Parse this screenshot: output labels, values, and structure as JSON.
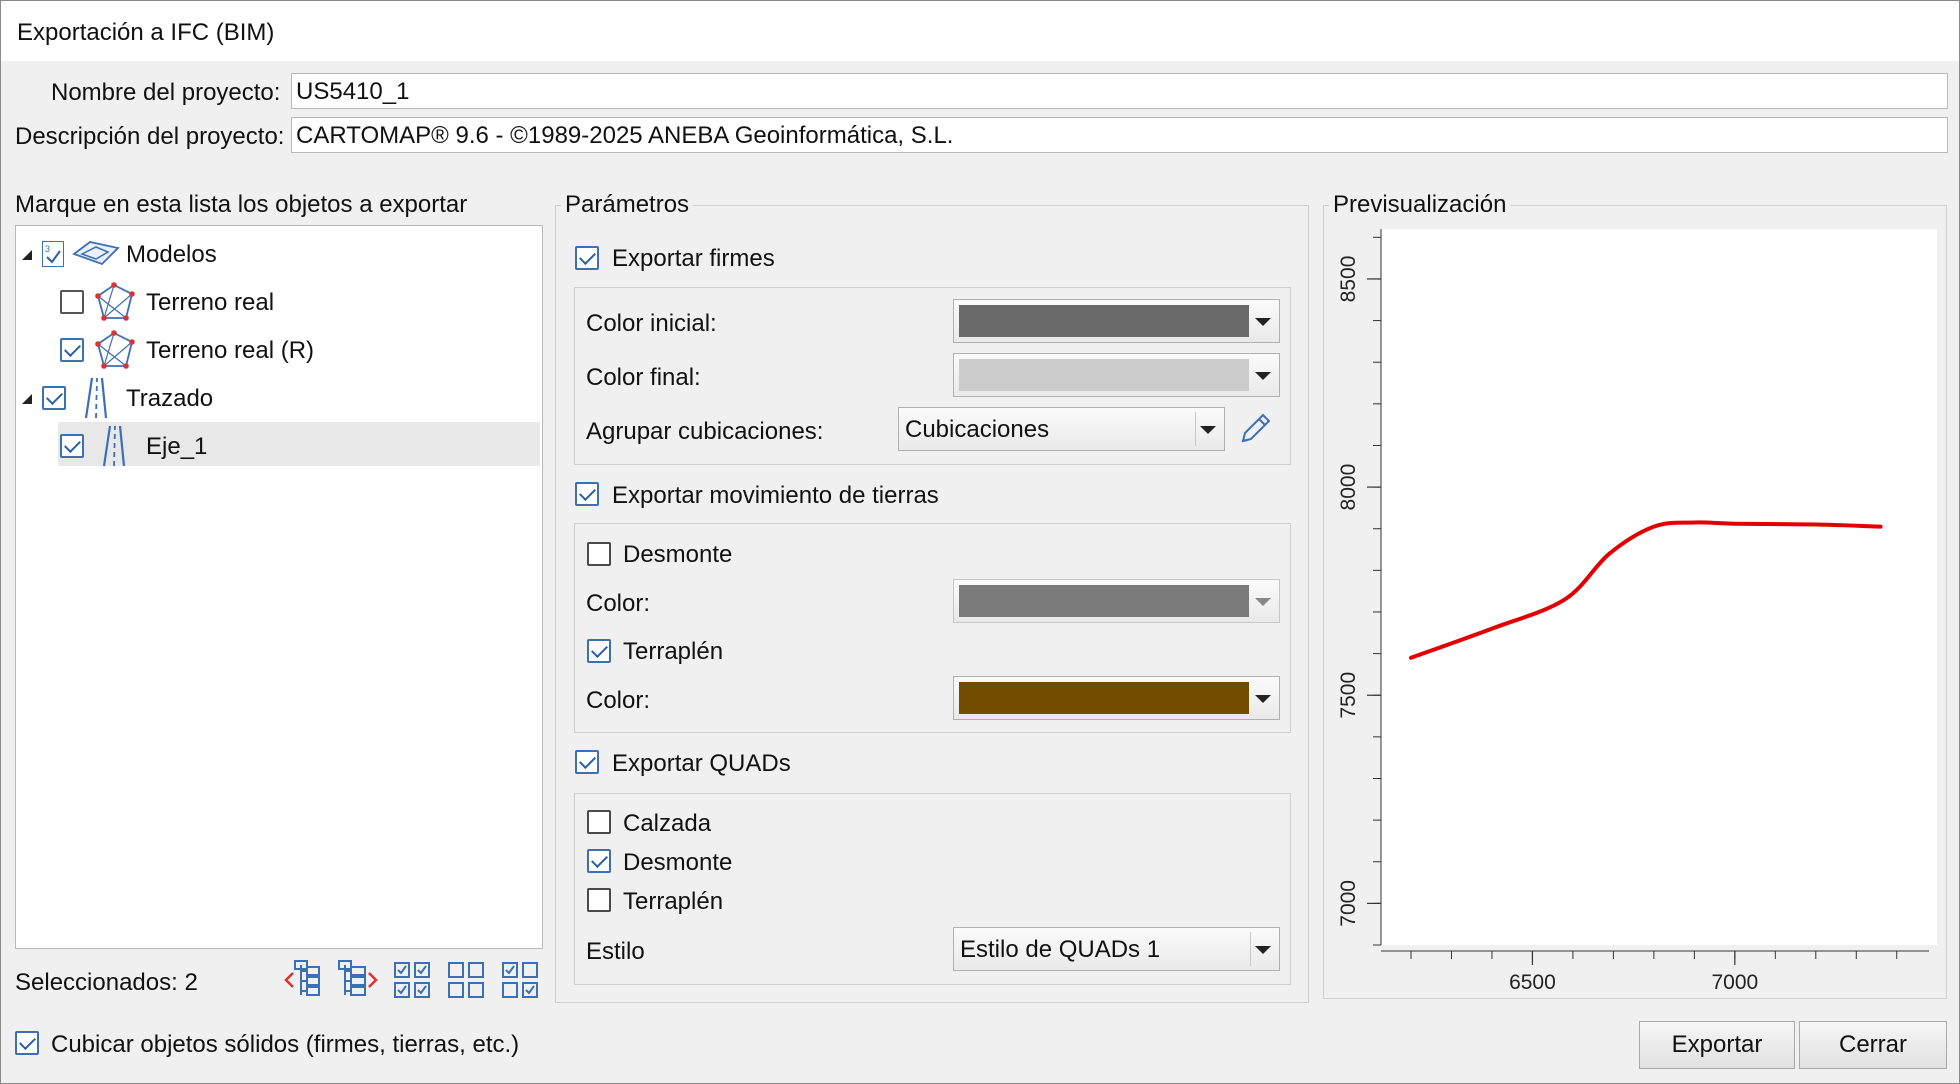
{
  "window": {
    "title": "Exportación a IFC (BIM)"
  },
  "project": {
    "name_label": "Nombre del proyecto:",
    "name_value": "US5410_1",
    "desc_label": "Descripción del proyecto:",
    "desc_value": "CARTOMAP® 9.6 - ©1989-2025 ANEBA Geoinformática, S.L."
  },
  "objects": {
    "title": "Marque en esta lista los objetos a exportar",
    "items": [
      {
        "label": "Modelos",
        "checked": true,
        "level": 0
      },
      {
        "label": "Terreno real",
        "checked": false,
        "level": 1
      },
      {
        "label": "Terreno real (R)",
        "checked": true,
        "level": 1
      },
      {
        "label": "Trazado",
        "checked": true,
        "level": 0
      },
      {
        "label": "Eje_1",
        "checked": true,
        "level": 1,
        "selected": true
      }
    ],
    "selected_count": "Seleccionados: 2",
    "toolbar_icons": [
      "collapse-tree-icon",
      "expand-tree-icon",
      "check-all-icon",
      "uncheck-all-icon",
      "invert-check-icon"
    ]
  },
  "params": {
    "title": "Parámetros",
    "firmes": {
      "label": "Exportar firmes",
      "checked": true,
      "color_inicial_label": "Color inicial:",
      "color_inicial": "#6a6a6a",
      "color_final_label": "Color final:",
      "color_final": "#cbcbcb",
      "agrupar_label": "Agrupar cubicaciones:",
      "agrupar_value": "Cubicaciones"
    },
    "tierras": {
      "label": "Exportar movimiento de tierras",
      "checked": true,
      "desmonte_label": "Desmonte",
      "desmonte_checked": false,
      "color1_label": "Color:",
      "color1": "#7a7a7a",
      "terraplen_label": "Terraplén",
      "terraplen_checked": true,
      "color2_label": "Color:",
      "color2": "#744c00"
    },
    "quads": {
      "label": "Exportar QUADs",
      "checked": true,
      "calzada_label": "Calzada",
      "calzada_checked": false,
      "desmonte_label": "Desmonte",
      "desmonte_checked": true,
      "terraplen_label": "Terraplén",
      "terraplen_checked": false,
      "estilo_label": "Estilo",
      "estilo_value": "Estilo de QUADs 1"
    }
  },
  "preview": {
    "title": "Previsualización",
    "line_color": "#e30000",
    "x_range": [
      6200,
      7450
    ],
    "y_range": [
      6900,
      8620
    ],
    "x_ticks": [
      "6500",
      "7000"
    ],
    "y_ticks": [
      "7000",
      "7500",
      "8000",
      "8500"
    ],
    "profile": [
      [
        6200,
        7590
      ],
      [
        6400,
        7660
      ],
      [
        6580,
        7730
      ],
      [
        6690,
        7840
      ],
      [
        6800,
        7905
      ],
      [
        6900,
        7915
      ],
      [
        7000,
        7912
      ],
      [
        7200,
        7910
      ],
      [
        7360,
        7905
      ]
    ]
  },
  "footer": {
    "cubicar_label": "Cubicar objetos sólidos (firmes, tierras, etc.)",
    "cubicar_checked": true,
    "export_button": "Exportar",
    "close_button": "Cerrar"
  }
}
